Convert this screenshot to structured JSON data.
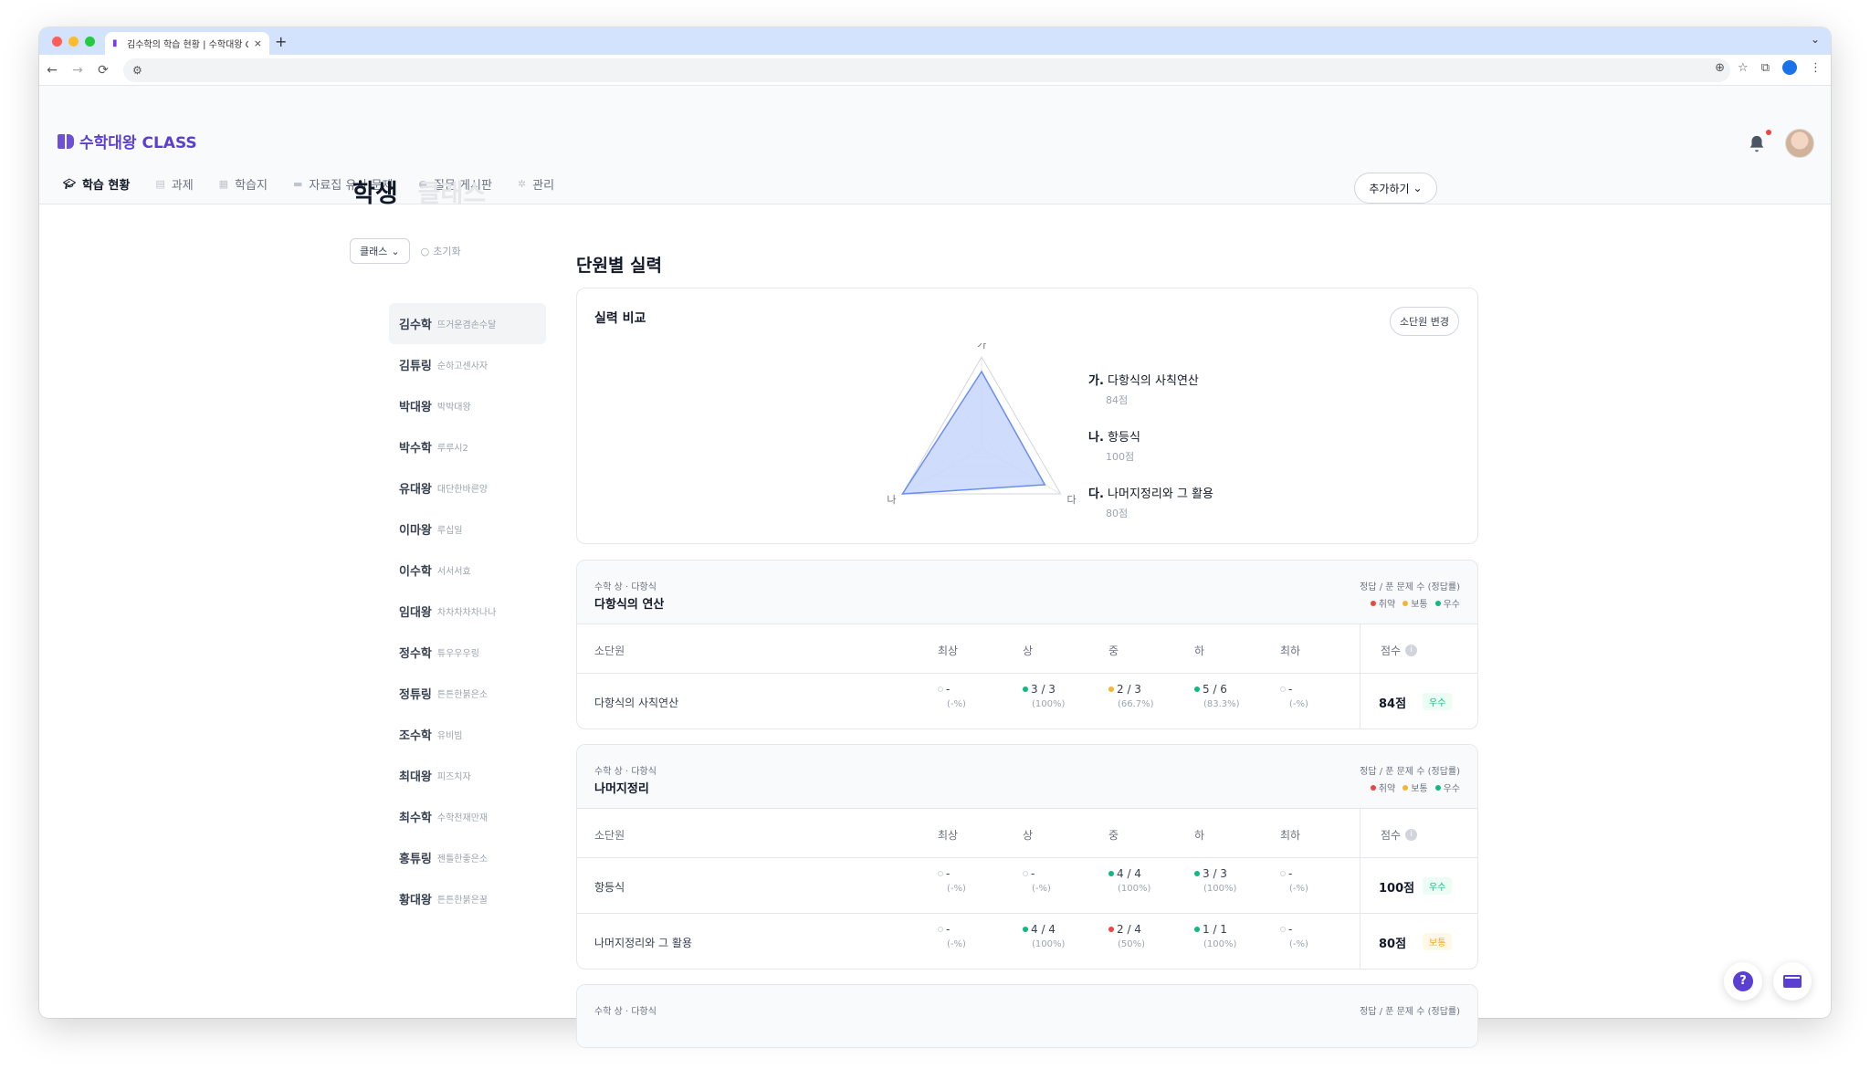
{
  "browser": {
    "tab_title": "김수학의 학습 현황 | 수학대왕 CLASS",
    "new_tab": "+",
    "close": "×",
    "back": "←",
    "forward": "→",
    "reload": "⟳"
  },
  "app": {
    "brand": "수학대왕 CLASS",
    "nav": [
      {
        "label": "학습 현황",
        "icon": "graduation-cap-icon"
      },
      {
        "label": "과제",
        "icon": "document-icon"
      },
      {
        "label": "학습지",
        "icon": "worksheet-icon"
      },
      {
        "label": "자료집 유사 문제",
        "icon": "folder-icon"
      },
      {
        "label": "질문 게시판",
        "icon": "chat-icon"
      },
      {
        "label": "관리",
        "icon": "gear-icon"
      }
    ]
  },
  "page": {
    "tab_student": "학생",
    "tab_class": "클래스",
    "add_button": "추가하기",
    "filter_class": "클래스",
    "filter_reset": "초기화",
    "section_title": "단원별 실력"
  },
  "students": [
    {
      "name": "김수학",
      "id": "뜨거운겸손수달"
    },
    {
      "name": "김튜링",
      "id": "순하고센사자"
    },
    {
      "name": "박대왕",
      "id": "박박대왕"
    },
    {
      "name": "박수학",
      "id": "루루시2"
    },
    {
      "name": "유대왕",
      "id": "대단한바른양"
    },
    {
      "name": "이마왕",
      "id": "루십일"
    },
    {
      "name": "이수학",
      "id": "서서서효"
    },
    {
      "name": "임대왕",
      "id": "차차차차차나나"
    },
    {
      "name": "정수학",
      "id": "튜우우우링"
    },
    {
      "name": "정튜링",
      "id": "튼튼한붉은소"
    },
    {
      "name": "조수학",
      "id": "유비빔"
    },
    {
      "name": "최대왕",
      "id": "피즈치자"
    },
    {
      "name": "최수학",
      "id": "수학천재만재"
    },
    {
      "name": "홍튜링",
      "id": "젠틀한좋은소"
    },
    {
      "name": "황대왕",
      "id": "튼튼한붉은꿀"
    }
  ],
  "radar": {
    "title": "실력 비교",
    "change_button": "소단원 변경",
    "axes": [
      "가",
      "나",
      "다"
    ],
    "items": [
      {
        "prefix": "가.",
        "name": "다항식의 사칙연산",
        "score": "84점",
        "value": 84
      },
      {
        "prefix": "나.",
        "name": "항등식",
        "score": "100점",
        "value": 100
      },
      {
        "prefix": "다.",
        "name": "나머지정리와 그 활용",
        "score": "80점",
        "value": 80
      }
    ],
    "fill_color": "#c7d6fb",
    "stroke_color": "#6b8df0"
  },
  "table_common": {
    "note": "정답 / 푼 문제 수 (정답률)",
    "legend": [
      "취약",
      "보통",
      "우수"
    ],
    "headers": {
      "name": "소단원",
      "c1": "최상",
      "c2": "상",
      "c3": "중",
      "c4": "하",
      "c5": "최하",
      "score": "점수"
    },
    "info": "i"
  },
  "units": [
    {
      "path": "수학 상 · 다항식",
      "name": "다항식의 연산",
      "rows": [
        {
          "name": "다항식의 사칙연산",
          "cells": [
            {
              "main": "-",
              "sub": "(-%)",
              "status": "empty"
            },
            {
              "main": "3 / 3",
              "sub": "(100%)",
              "status": "green"
            },
            {
              "main": "2 / 3",
              "sub": "(66.7%)",
              "status": "yellow"
            },
            {
              "main": "5 / 6",
              "sub": "(83.3%)",
              "status": "green"
            },
            {
              "main": "-",
              "sub": "(-%)",
              "status": "empty"
            }
          ],
          "score": "84점",
          "badge": "우수",
          "badge_type": "good"
        }
      ]
    },
    {
      "path": "수학 상 · 다항식",
      "name": "나머지정리",
      "rows": [
        {
          "name": "항등식",
          "cells": [
            {
              "main": "-",
              "sub": "(-%)",
              "status": "empty"
            },
            {
              "main": "-",
              "sub": "(-%)",
              "status": "empty"
            },
            {
              "main": "4 / 4",
              "sub": "(100%)",
              "status": "green"
            },
            {
              "main": "3 / 3",
              "sub": "(100%)",
              "status": "green"
            },
            {
              "main": "-",
              "sub": "(-%)",
              "status": "empty"
            }
          ],
          "score": "100점",
          "badge": "우수",
          "badge_type": "good"
        },
        {
          "name": "나머지정리와 그 활용",
          "cells": [
            {
              "main": "-",
              "sub": "(-%)",
              "status": "empty"
            },
            {
              "main": "4 / 4",
              "sub": "(100%)",
              "status": "green"
            },
            {
              "main": "2 / 4",
              "sub": "(50%)",
              "status": "red"
            },
            {
              "main": "1 / 1",
              "sub": "(100%)",
              "status": "green"
            },
            {
              "main": "-",
              "sub": "(-%)",
              "status": "empty"
            }
          ],
          "score": "80점",
          "badge": "보통",
          "badge_type": "mid"
        }
      ]
    },
    {
      "path": "수학 상 · 다항식",
      "name": "",
      "rows": []
    }
  ],
  "fab": {
    "help": "?"
  }
}
